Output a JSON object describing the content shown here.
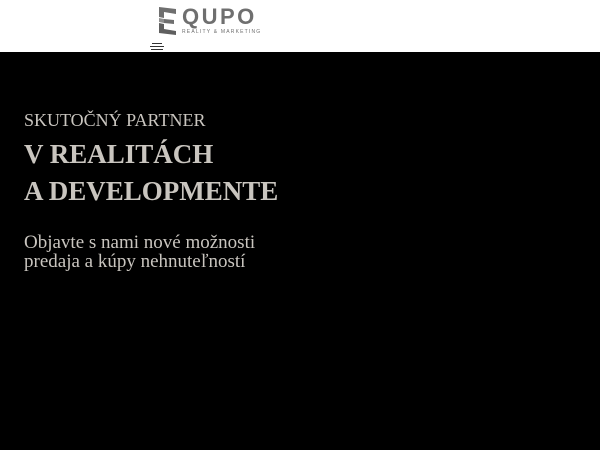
{
  "header": {
    "brand": "QUPO",
    "brand_subtitle": "REALITY & MARKETING",
    "logo_icon": "stacked-e-logo-icon",
    "menu_icon": "hamburger-menu-icon",
    "colors": {
      "background": "#ffffff",
      "logo": "#6f6f6f"
    }
  },
  "hero": {
    "kicker": "SKUTOČNÝ PARTNER",
    "headline_line1": "V REALITÁCH",
    "headline_line2": "A DEVELOPMENTE",
    "lead": "Objavte s nami nové možnosti predaja a kúpy nehnuteľností",
    "colors": {
      "background": "#000000",
      "text": "#c9c5bf"
    }
  }
}
